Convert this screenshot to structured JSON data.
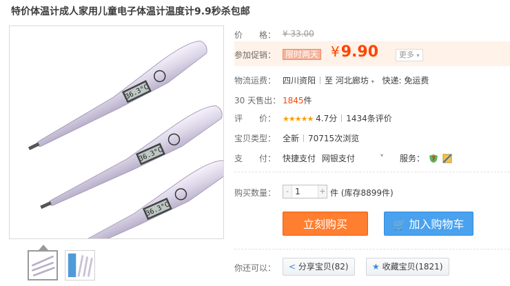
{
  "title": "特价体温计成人家用儿童电子体温计温度计9.9秒杀包邮",
  "price": {
    "label": "价　　格：",
    "original": "¥ 33.00"
  },
  "promo": {
    "label": "参加促销：",
    "tag": "限时两天",
    "currency": "¥",
    "amount": "9.90",
    "more_label": "更多"
  },
  "shipping": {
    "label": "物流运费：",
    "origin": "四川资阳",
    "to_word": "至",
    "destination": "河北廊坊",
    "fee_text": "快递: 免运费"
  },
  "sales": {
    "label": "30 天售出：",
    "count": "1845",
    "unit": "件"
  },
  "rating": {
    "label": "评　　价：",
    "stars": "★★★★★",
    "score": "4.7分",
    "reviews": "1434条评价"
  },
  "item_type": {
    "label": "宝贝类型：",
    "condition": "全新",
    "views": "70715次浏览"
  },
  "payment": {
    "label": "支　　付：",
    "methods": [
      "快捷支付",
      "网银支付"
    ],
    "service_label": "服务："
  },
  "quantity": {
    "label": "购买数量：",
    "value": "1",
    "minus": "-",
    "plus": "+",
    "unit_stock": "件 (库存8899件)"
  },
  "buttons": {
    "buy_now": "立刻购买",
    "add_to_cart": "加入购物车"
  },
  "share": {
    "label": "你还可以：",
    "share_text": "分享宝贝(82)",
    "collect_text": "收藏宝贝(1821)"
  },
  "product_display": "36.3°C",
  "colors": {
    "accent": "#ff4400",
    "buy": "#ff7e2f",
    "cart": "#4aa2ee",
    "star": "#ff9d00"
  },
  "icons": [
    "chevron-down-icon",
    "share-icon",
    "star-icon",
    "cart-icon",
    "service-shield-icon",
    "service-quality-icon",
    "caret-down-icon"
  ]
}
